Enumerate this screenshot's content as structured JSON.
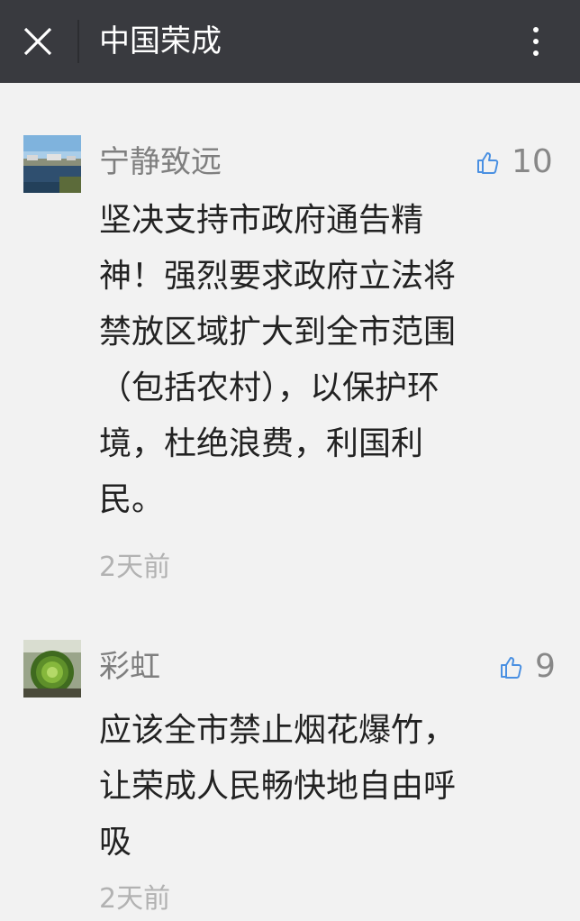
{
  "header": {
    "title": "中国荣成",
    "close_icon": "close-icon",
    "more_icon": "more-vertical-icon"
  },
  "comments": [
    {
      "nickname": "宁静致远",
      "likes": "10",
      "content": "坚决支持市政府通告精\n神！强烈要求政府立法将\n禁放区域扩大到全市范围\n（包括农村），以保护环\n境，杜绝浪费，利国利\n民。",
      "time": "2天前",
      "avatar": "lake-landscape-avatar",
      "like_icon": "thumbs-up-icon"
    },
    {
      "nickname": "彩虹",
      "likes": "9",
      "content": "应该全市禁止烟花爆竹，\n让荣成人民畅快地自由呼\n吸",
      "time": "2天前",
      "avatar": "succulent-plant-avatar",
      "like_icon": "thumbs-up-icon"
    }
  ],
  "colors": {
    "header_bg": "#393a3f",
    "page_bg": "#f2f2f2",
    "like_icon": "#4a90e2",
    "nickname": "#7f7f7f",
    "timestamp": "#b2b2b2"
  }
}
